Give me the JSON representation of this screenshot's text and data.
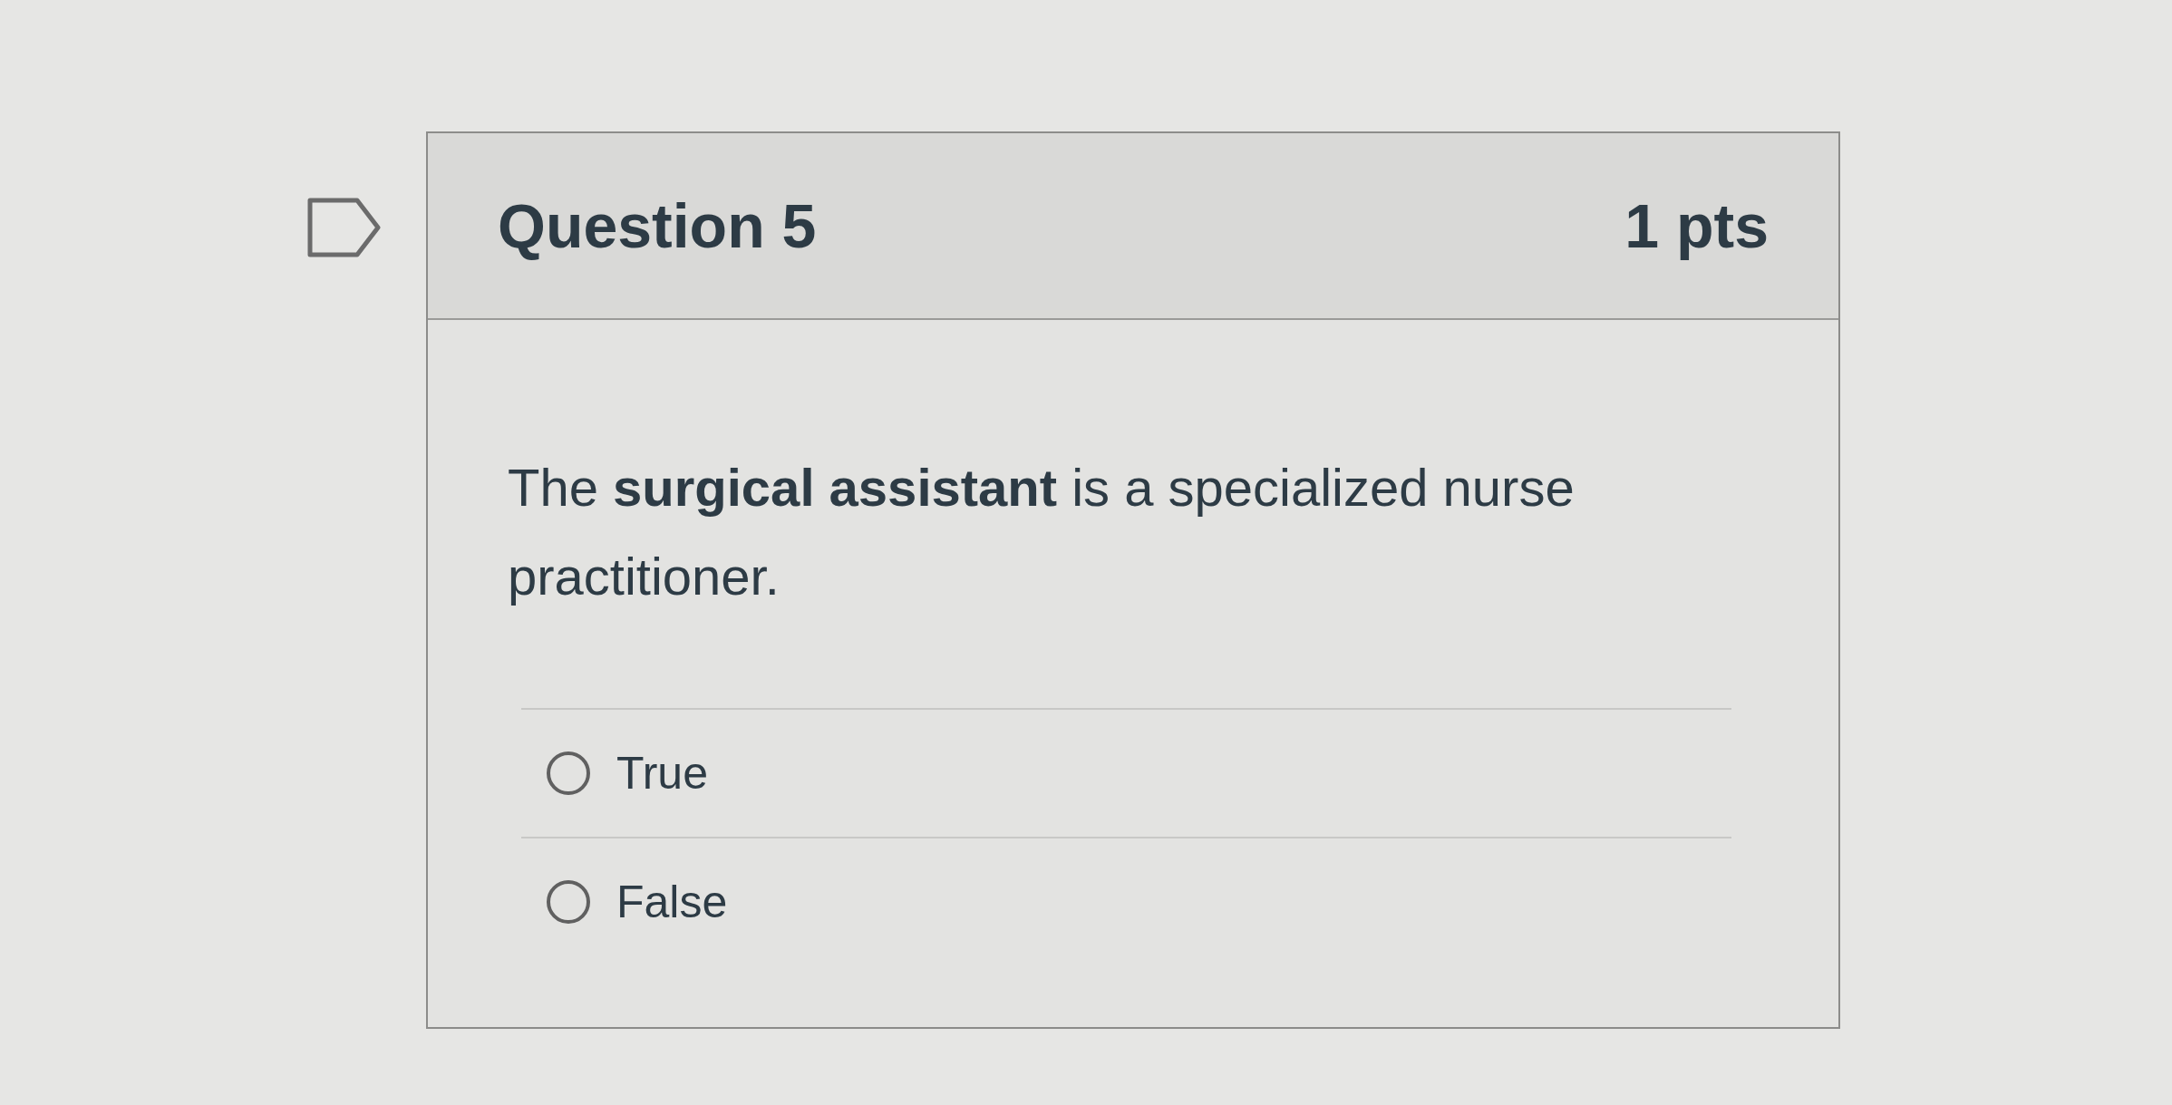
{
  "question": {
    "flagged": false,
    "title": "Question 5",
    "points": "1 pts",
    "text": "The **surgical assistant** is a specialized nurse practitioner.",
    "answers": [
      {
        "label": "True",
        "selected": false
      },
      {
        "label": "False",
        "selected": false
      }
    ]
  }
}
